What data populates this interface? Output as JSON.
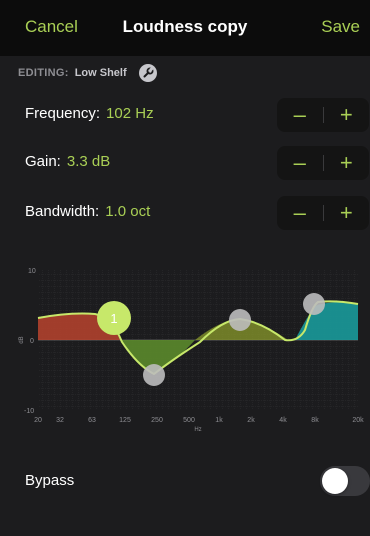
{
  "navbar": {
    "cancel_label": "Cancel",
    "title": "Loudness copy",
    "save_label": "Save"
  },
  "editing": {
    "label": "EDITING:",
    "value": "Low Shelf",
    "icon": "wrench-icon"
  },
  "params": [
    {
      "label": "Frequency:",
      "value": "102 Hz",
      "minus": "–",
      "plus": "+"
    },
    {
      "label": "Gain:",
      "value": "3.3 dB",
      "minus": "–",
      "plus": "+"
    },
    {
      "label": "Bandwidth:",
      "value": "1.0 oct",
      "minus": "–",
      "plus": "+"
    }
  ],
  "graph": {
    "y_ticks": [
      "10",
      "0",
      "-10"
    ],
    "ylabel": "dB",
    "x_ticks": [
      "20",
      "32",
      "63",
      "125",
      "250",
      "500",
      "1k",
      "2k",
      "4k",
      "8k",
      "20k"
    ],
    "xlabel": "Hz",
    "active_band_label": "1",
    "colors": {
      "accent": "#a9cf55",
      "low": "#c0392b",
      "mid": "#5b8a2b",
      "high": "#1a9a9a"
    }
  },
  "bypass": {
    "label": "Bypass",
    "on": false
  }
}
